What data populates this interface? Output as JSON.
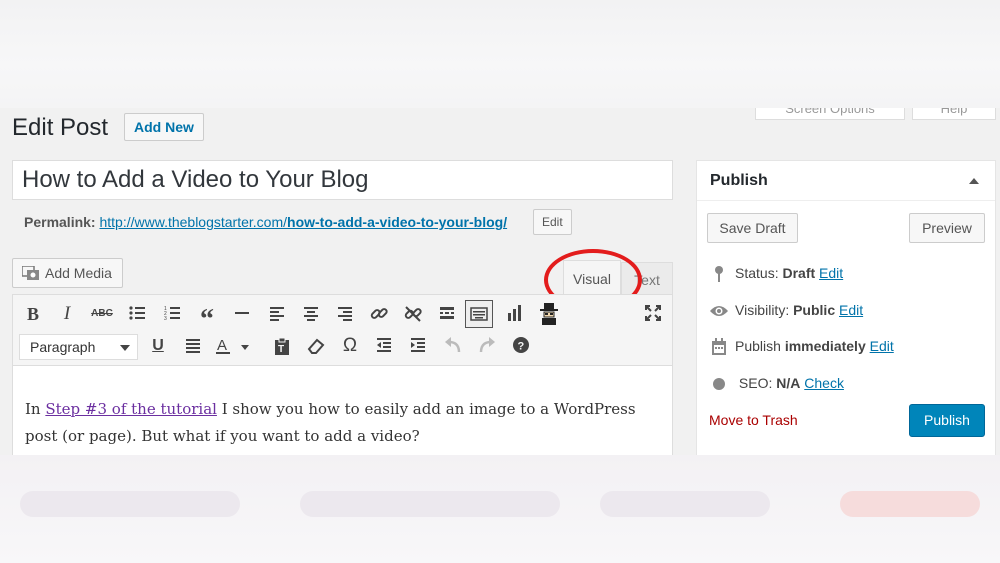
{
  "header": {
    "screen_options": "Screen Options",
    "help": "Help",
    "page_title": "Edit Post",
    "add_new": "Add New"
  },
  "post": {
    "title": "How to Add a Video to Your Blog",
    "permalink_label": "Permalink:",
    "permalink_base": "http://www.theblogstarter.com/",
    "permalink_slug": "how-to-add-a-video-to-your-blog/",
    "permalink_edit": "Edit"
  },
  "editor": {
    "add_media": "Add Media",
    "tab_visual": "Visual",
    "tab_text": "Text",
    "format_select": "Paragraph",
    "toolbar_row1": [
      "bold-icon",
      "italic-icon",
      "strikethrough-icon",
      "bulleted-list-icon",
      "numbered-list-icon",
      "blockquote-icon",
      "horizontal-line-icon",
      "align-left-icon",
      "align-center-icon",
      "align-right-icon",
      "insert-link-icon",
      "remove-link-icon",
      "insert-read-more-icon",
      "toolbar-toggle-icon",
      "chart-icon",
      "custom-plugin-icon",
      "fullscreen-icon"
    ],
    "toolbar_row2": [
      "underline-icon",
      "justify-icon",
      "text-color-icon",
      "paste-as-text-icon",
      "clear-formatting-icon",
      "special-character-icon",
      "decrease-indent-icon",
      "increase-indent-icon",
      "undo-icon",
      "redo-icon",
      "help-icon"
    ],
    "content_prefix": "In ",
    "content_link": "Step #3 of the tutorial",
    "content_rest": " I show you how to easily add an image to a WordPress post (or page).  But what if you want to add a video?"
  },
  "publish": {
    "heading": "Publish",
    "save_draft": "Save Draft",
    "preview": "Preview",
    "status_label": "Status:",
    "status_value": "Draft",
    "visibility_label": "Visibility:",
    "visibility_value": "Public",
    "publish_label": "Publish",
    "publish_value": "immediately",
    "seo_label": "SEO:",
    "seo_value": "N/A",
    "edit": "Edit",
    "check": "Check",
    "move_to_trash": "Move to Trash",
    "publish_button": "Publish"
  },
  "colors": {
    "annotation_circle": "#e31c1c",
    "primary_button": "#0085ba",
    "link": "#0073aa",
    "trash": "#a00000"
  }
}
